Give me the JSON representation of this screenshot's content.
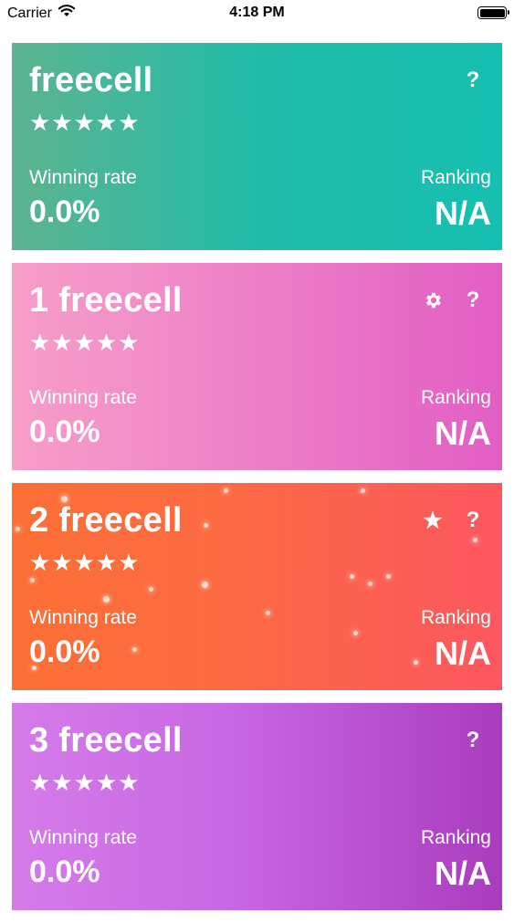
{
  "status_bar": {
    "carrier": "Carrier",
    "time": "4:18 PM"
  },
  "cards": [
    {
      "title": "freecell",
      "stars": "★★★★★",
      "winning_rate_label": "Winning rate",
      "winning_rate_value": "0.0%",
      "ranking_label": "Ranking",
      "ranking_value": "N/A",
      "icons": [
        "help-icon"
      ],
      "gradient": [
        "#5db38f",
        "#15bfb0"
      ]
    },
    {
      "title": "1 freecell",
      "stars": "★★★★★",
      "winning_rate_label": "Winning rate",
      "winning_rate_value": "0.0%",
      "ranking_label": "Ranking",
      "ranking_value": "N/A",
      "icons": [
        "gear-icon",
        "help-icon"
      ],
      "gradient": [
        "#f79ec9",
        "#e25ec4"
      ]
    },
    {
      "title": "2 freecell",
      "stars": "★★★★★",
      "winning_rate_label": "Winning rate",
      "winning_rate_value": "0.0%",
      "ranking_label": "Ranking",
      "ranking_value": "N/A",
      "icons": [
        "star-icon",
        "help-icon"
      ],
      "gradient": [
        "#fb6f35",
        "#fc5760"
      ]
    },
    {
      "title": "3 freecell",
      "stars": "★★★★★",
      "winning_rate_label": "Winning rate",
      "winning_rate_value": "0.0%",
      "ranking_label": "Ranking",
      "ranking_value": "N/A",
      "icons": [
        "help-icon"
      ],
      "gradient": [
        "#d57be9",
        "#a93cbe"
      ]
    }
  ],
  "help_symbol": "?",
  "star_symbol": "★"
}
